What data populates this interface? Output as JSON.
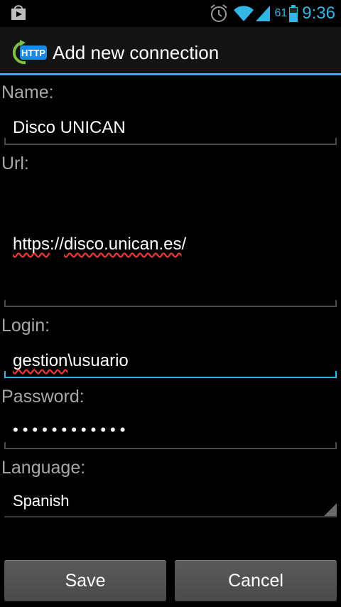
{
  "status_bar": {
    "battery_level": "61",
    "time": "9:36",
    "icons": [
      "shop-bag-icon",
      "alarm-icon",
      "wifi-icon",
      "signal-icon",
      "battery-icon"
    ]
  },
  "action_bar": {
    "icon": "http-refresh-icon",
    "icon_text": "HTTP",
    "title": "Add new connection"
  },
  "form": {
    "name": {
      "label": "Name:",
      "value": "Disco UNICAN"
    },
    "url": {
      "label": "Url:",
      "value_part1": "https",
      "value_part2": "://",
      "value_part3": "disco.unican.es",
      "value_part4": "/"
    },
    "login": {
      "label": "Login:",
      "value_part1": "gestion",
      "value_part2": "\\usuario"
    },
    "password": {
      "label": "Password:",
      "value": "••••••••••••"
    },
    "language": {
      "label": "Language:",
      "value": "Spanish"
    }
  },
  "buttons": {
    "save": "Save",
    "cancel": "Cancel"
  },
  "colors": {
    "accent": "#33b5e5",
    "background": "#000000",
    "spellcheck": "#e53935"
  }
}
